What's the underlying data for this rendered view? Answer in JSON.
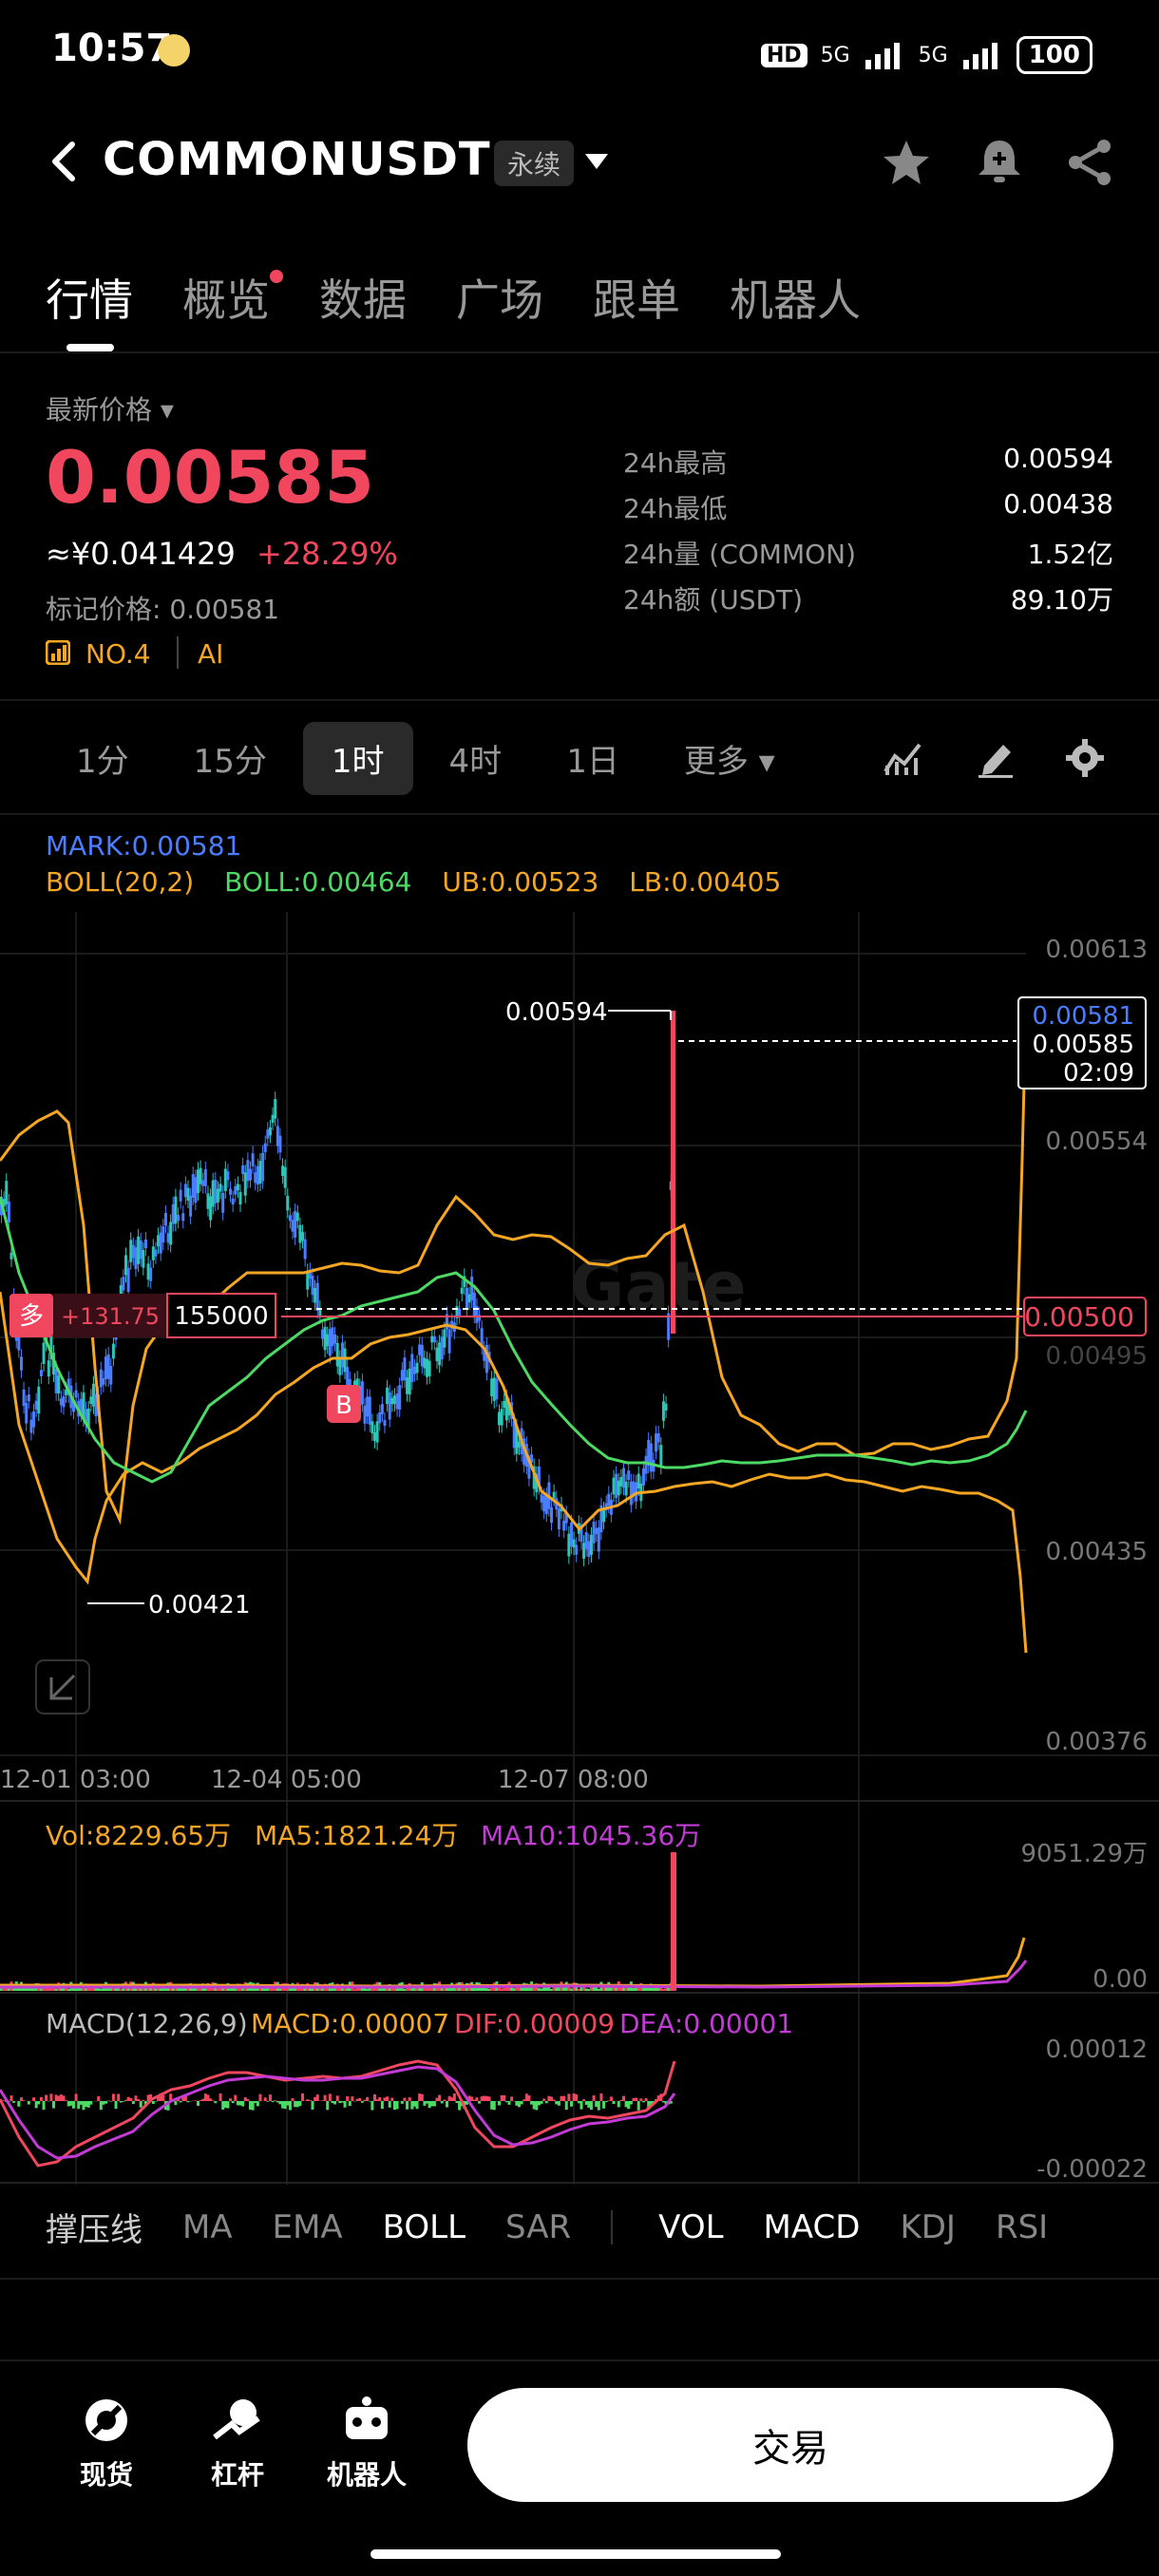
{
  "status": {
    "time": "10:57",
    "hd": "HD",
    "net1": "5G",
    "net2": "5G",
    "battery": "100"
  },
  "header": {
    "title": "COMMONUSDT",
    "badge": "永续"
  },
  "tabs": [
    "行情",
    "概览",
    "数据",
    "广场",
    "跟单",
    "机器人"
  ],
  "price": {
    "label": "最新价格",
    "last": "0.00585",
    "cny": "≈¥0.041429",
    "change": "+28.29%",
    "mark_label": "标记价格: 0.00581",
    "rank": "NO.4",
    "ai": "AI"
  },
  "stats": [
    {
      "label": "24h最高",
      "value": "0.00594"
    },
    {
      "label": "24h最低",
      "value": "0.00438"
    },
    {
      "label": "24h量 (COMMON)",
      "value": "1.52亿"
    },
    {
      "label": "24h额 (USDT)",
      "value": "89.10万"
    }
  ],
  "intervals": [
    "1分",
    "15分",
    "1时",
    "4时",
    "1日",
    "更多"
  ],
  "chart": {
    "mark": "MARK:0.00581",
    "boll": "BOLL(20,2)",
    "boll_mid": "BOLL:0.00464",
    "ub": "UB:0.00523",
    "lb": "LB:0.00405",
    "y_ticks": [
      "0.00613",
      "0.00554",
      "0.00495",
      "0.00435",
      "0.00376"
    ],
    "x_ticks": [
      "12-01 03:00",
      "12-04 05:00",
      "12-07 08:00"
    ],
    "high_label": "0.00594",
    "low_label": "0.00421",
    "box_mark": "0.00581",
    "box_last": "0.00585",
    "box_time": "02:09",
    "pos_side": "多",
    "pos_pnl": "+131.75",
    "pos_qty": "155000",
    "pos_price": "0.00500",
    "marker": "B",
    "watermark": "Gate"
  },
  "volume": {
    "vol": "Vol:8229.65万",
    "ma5": "MA5:1821.24万",
    "ma10": "MA10:1045.36万",
    "top": "9051.29万",
    "bottom": "0.00"
  },
  "macd": {
    "title": "MACD(12,26,9)",
    "macd": "MACD:0.00007",
    "dif": "DIF:0.00009",
    "dea": "DEA:0.00001",
    "top": "0.00012",
    "bottom": "-0.00022"
  },
  "indicators": [
    "撑压线",
    "MA",
    "EMA",
    "BOLL",
    "SAR",
    "VOL",
    "MACD",
    "KDJ",
    "RSI"
  ],
  "nav": {
    "spot": "现货",
    "margin": "杠杆",
    "bot": "机器人",
    "trade": "交易"
  },
  "colors": {
    "up": "#f0475f",
    "boll": "#f5a623",
    "mid": "#4cd964",
    "mark": "#4a7dff",
    "macd_dif": "#f0475f",
    "macd_dea": "#c23bd4"
  }
}
